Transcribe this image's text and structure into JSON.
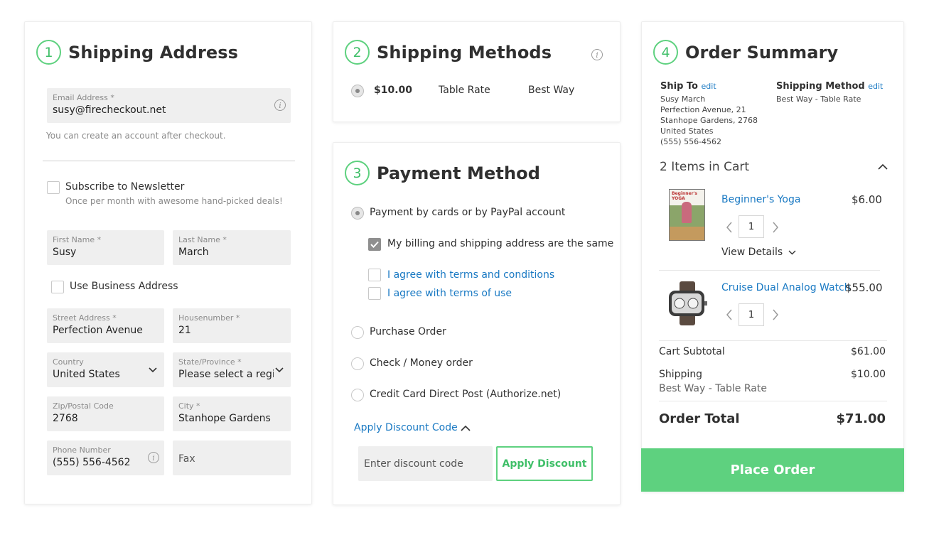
{
  "shipping_address": {
    "step": "1",
    "title": "Shipping Address",
    "email": {
      "label": "Email Address *",
      "value": "susy@firecheckout.net"
    },
    "account_note": "You can create an account after checkout.",
    "newsletter": {
      "label": "Subscribe to Newsletter",
      "note": "Once per month with awesome hand-picked deals!"
    },
    "first_name": {
      "label": "First Name *",
      "value": "Susy"
    },
    "last_name": {
      "label": "Last Name *",
      "value": "March"
    },
    "business": {
      "label": "Use Business Address"
    },
    "street": {
      "label": "Street Address *",
      "value": "Perfection Avenue"
    },
    "housenumber": {
      "label": "Housenumber *",
      "value": "21"
    },
    "country": {
      "label": "Country",
      "value": "United States"
    },
    "state": {
      "label": "State/Province *",
      "value": "Please select a region"
    },
    "zip": {
      "label": "Zip/Postal Code",
      "value": "2768"
    },
    "city": {
      "label": "City *",
      "value": "Stanhope Gardens"
    },
    "phone": {
      "label": "Phone Number",
      "value": "(555) 556-4562"
    },
    "fax": {
      "placeholder": "Fax"
    }
  },
  "shipping_methods": {
    "step": "2",
    "title": "Shipping Methods",
    "options": [
      {
        "price": "$10.00",
        "carrier": "Table Rate",
        "method": "Best Way"
      }
    ]
  },
  "payment": {
    "step": "3",
    "title": "Payment Method",
    "options": {
      "cards": "Payment by cards or by PayPal account",
      "purchase_order": "Purchase Order",
      "check": "Check / Money order",
      "credit_card": "Credit Card Direct Post (Authorize.net)"
    },
    "same_address": "My billing and shipping address are the same",
    "terms_conditions": "I agree with terms and conditions",
    "terms_use": "I agree with terms of use",
    "discount_toggle": "Apply Discount Code",
    "discount_placeholder": "Enter discount code",
    "apply_button": "Apply Discount"
  },
  "summary": {
    "step": "4",
    "title": "Order Summary",
    "ship_to": {
      "label": "Ship To",
      "edit": "edit",
      "name": "Susy March",
      "street": "Perfection Avenue, 21",
      "city": "Stanhope Gardens, 2768",
      "country": "United States",
      "phone": "(555) 556-4562"
    },
    "shipping_method": {
      "label": "Shipping Method",
      "edit": "edit",
      "value": "Best Way - Table Rate"
    },
    "items_count": "2 Items in Cart",
    "items": [
      {
        "name": "Beginner's Yoga",
        "price": "$6.00",
        "qty": "1",
        "details": "View Details"
      },
      {
        "name": "Cruise Dual Analog Watch",
        "price": "$55.00",
        "qty": "1"
      }
    ],
    "yoga_cover_text": "Beginner's YOGA",
    "subtotal_label": "Cart Subtotal",
    "subtotal_value": "$61.00",
    "shipping_label": "Shipping",
    "shipping_value": "$10.00",
    "shipping_sub": "Best Way - Table Rate",
    "total_label": "Order Total",
    "total_value": "$71.00",
    "place_order": "Place Order"
  },
  "colors": {
    "accent": "#5ed17f",
    "link": "#1979c3"
  },
  "icons": [
    "info-icon",
    "chevron-down-icon",
    "chevron-up-icon",
    "chevron-left-icon",
    "chevron-right-icon",
    "checkmark-icon"
  ]
}
